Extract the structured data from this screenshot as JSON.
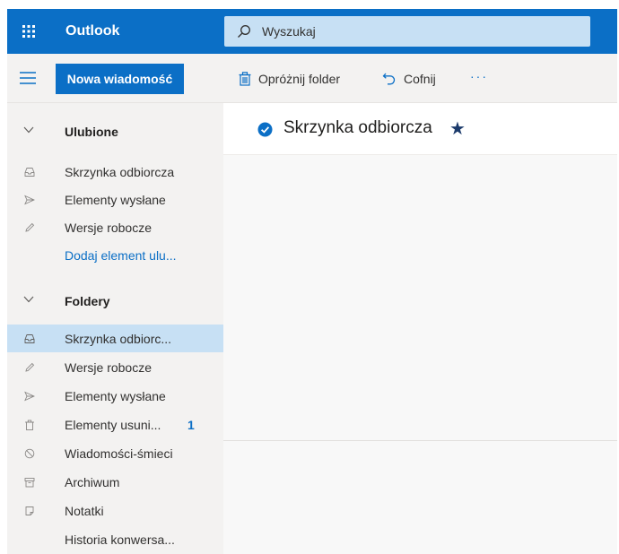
{
  "app": {
    "brand": "Outlook"
  },
  "search": {
    "placeholder": "Wyszukaj"
  },
  "toolbar": {
    "new_message_label": "Nowa wiadomość",
    "empty_folder_label": "Opróżnij folder",
    "undo_label": "Cofnij",
    "more_label": "···"
  },
  "sidebar": {
    "favorites": {
      "header": "Ulubione",
      "items": [
        {
          "label": "Skrzynka odbiorcza",
          "icon": "inbox-icon"
        },
        {
          "label": "Elementy wysłane",
          "icon": "send-icon"
        },
        {
          "label": "Wersje robocze",
          "icon": "pencil-icon"
        },
        {
          "label": "Dodaj element ulu...",
          "icon": ""
        }
      ]
    },
    "folders": {
      "header": "Foldery",
      "items": [
        {
          "label": "Skrzynka odbiorc...",
          "icon": "inbox-icon",
          "selected": true
        },
        {
          "label": "Wersje robocze",
          "icon": "pencil-icon"
        },
        {
          "label": "Elementy wysłane",
          "icon": "send-icon"
        },
        {
          "label": "Elementy usuni...",
          "icon": "trash-icon",
          "count": "1"
        },
        {
          "label": "Wiadomości-śmieci",
          "icon": "block-icon"
        },
        {
          "label": "Archiwum",
          "icon": "archive-icon"
        },
        {
          "label": "Notatki",
          "icon": "note-icon"
        },
        {
          "label": "Historia konwersa...",
          "icon": ""
        }
      ]
    }
  },
  "main": {
    "title": "Skrzynka odbiorcza",
    "favorite_star": "★"
  },
  "colors": {
    "accent": "#0b6fc6",
    "selected": "#c7e0f4",
    "pane": "#f3f2f1"
  }
}
